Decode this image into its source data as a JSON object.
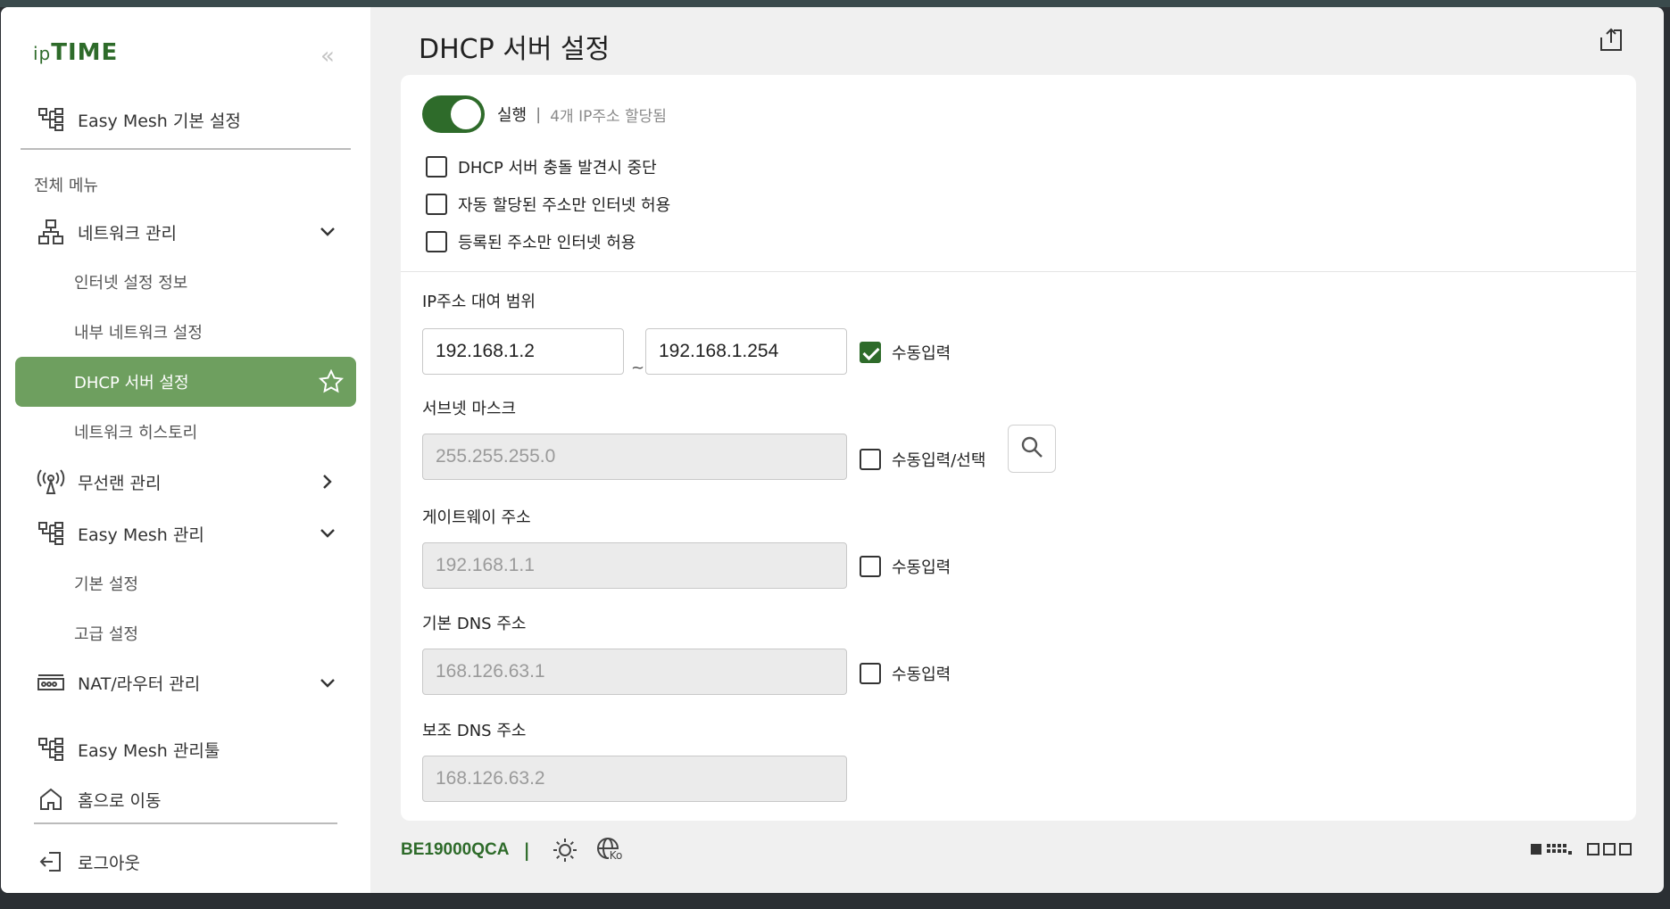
{
  "sidebar": {
    "logo": "ipTIME",
    "logo_ip": "ip",
    "logo_time": "TIME",
    "collapse_glyph": "«",
    "top_item": "Easy Mesh 기본 설정",
    "section_title": "전체 메뉴",
    "groups": {
      "network": "네트워크 관리",
      "internet_info": "인터넷 설정 정보",
      "lan": "내부 네트워크 설정",
      "dhcp": "DHCP 서버 설정",
      "history": "네트워크 히스토리",
      "wireless": "무선랜 관리",
      "easymesh": "Easy Mesh 관리",
      "basic": "기본 설정",
      "advanced": "고급 설정",
      "nat": "NAT/라우터 관리"
    },
    "bottom": {
      "meshtool": "Easy Mesh 관리툴",
      "home": "홈으로 이동",
      "logout": "로그아웃"
    }
  },
  "main": {
    "title": "DHCP 서버 설정",
    "toggle_label": "실행",
    "toggle_sep": "|",
    "toggle_status": "4개 IP주소 할당됨",
    "options": [
      "DHCP 서버 충돌 발견시 중단",
      "자동 할당된 주소만 인터넷 허용",
      "등록된 주소만 인터넷 허용"
    ],
    "ip_range": {
      "label": "IP주소 대여 범위",
      "start": "192.168.1.2",
      "tilde": "~",
      "end": "192.168.1.254",
      "manual": "수동입력"
    },
    "subnet": {
      "label": "서브넷 마스크",
      "value": "255.255.255.0",
      "manual": "수동입력/선택"
    },
    "gateway": {
      "label": "게이트웨이 주소",
      "value": "192.168.1.1",
      "manual": "수동입력"
    },
    "dns1": {
      "label": "기본 DNS 주소",
      "value": "168.126.63.1",
      "manual": "수동입력"
    },
    "dns2": {
      "label": "보조 DNS 주소",
      "value": "168.126.63.2"
    }
  },
  "footer": {
    "model": "BE19000QCA",
    "sep": "|",
    "lang": "Ko"
  },
  "colors": {
    "brand": "#2e6b2a",
    "active_nav": "#6e9f5f"
  }
}
